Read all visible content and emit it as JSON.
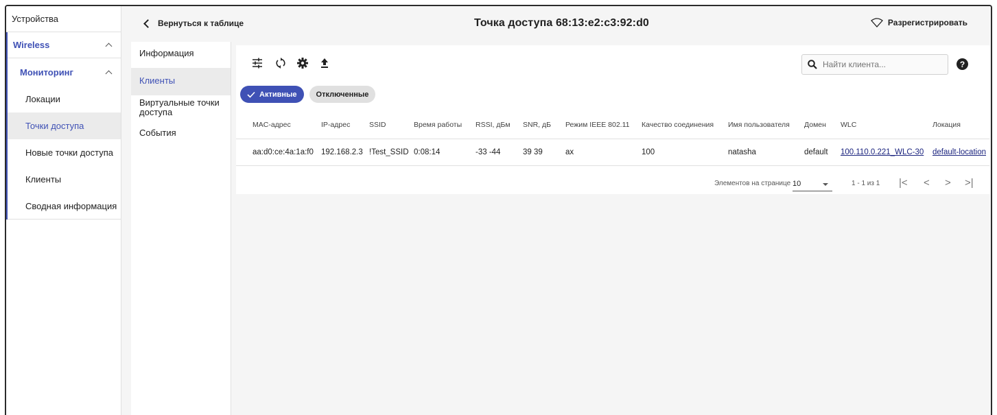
{
  "nav": {
    "root": "Устройства",
    "wireless": "Wireless",
    "monitoring": "Мониторинг",
    "items": [
      {
        "label": "Локации"
      },
      {
        "label": "Точки доступа"
      },
      {
        "label": "Новые точки доступа"
      },
      {
        "label": "Клиенты"
      },
      {
        "label": "Сводная информация"
      }
    ]
  },
  "header": {
    "back_label": "Вернуться к таблице",
    "title": "Точка доступа 68:13:e2:c3:92:d0",
    "unregister_label": "Разрегистрировать"
  },
  "submenu": {
    "items": [
      {
        "label": "Информация"
      },
      {
        "label": "Клиенты"
      },
      {
        "label": "Виртуальные точки доступа"
      },
      {
        "label": "События"
      }
    ]
  },
  "toolbar": {
    "search_placeholder": "Найти клиента...",
    "help_glyph": "?"
  },
  "filters": {
    "active_label": "Активные",
    "disconnected_label": "Отключенные"
  },
  "table": {
    "columns": [
      "MAC-адрес",
      "IP-адрес",
      "SSID",
      "Время работы",
      "RSSI, дБм",
      "SNR, дБ",
      "Режим IEEE 802.11",
      "Качество соединения",
      "Имя пользователя",
      "Домен",
      "WLC",
      "Локация"
    ],
    "rows": [
      [
        "aa:d0:ce:4a:1a:f0",
        "192.168.2.3",
        "!Test_SSID",
        "0:08:14",
        "-33 -44",
        "39 39",
        "ax",
        "100",
        "natasha",
        "default",
        "100.110.0.221_WLC-30",
        "default-location"
      ]
    ]
  },
  "pager": {
    "per_page_label": "Элементов на странице",
    "per_page_value": "10",
    "range": "1 - 1 из 1"
  }
}
